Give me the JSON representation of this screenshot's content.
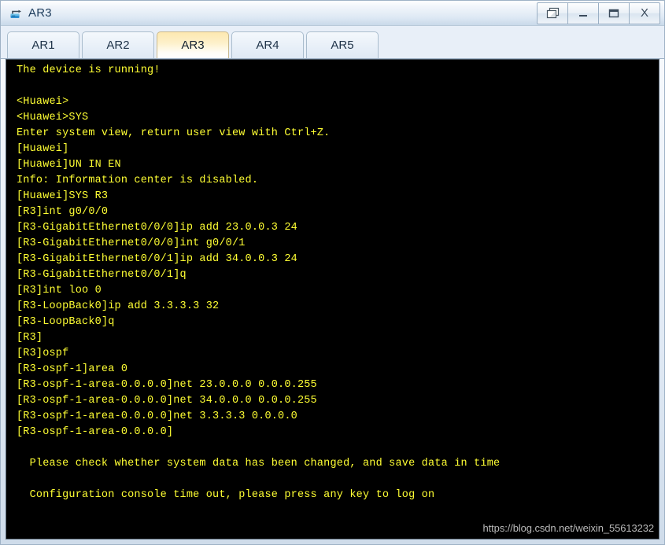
{
  "window": {
    "title": "AR3",
    "icon": "router-device-icon",
    "controls": [
      {
        "name": "restore-cascade-button",
        "label": "",
        "icon": "cascade-windows-icon"
      },
      {
        "name": "minimize-button",
        "label": "",
        "icon": "minimize-icon"
      },
      {
        "name": "maximize-button",
        "label": "",
        "icon": "maximize-icon"
      },
      {
        "name": "close-button",
        "label": "X",
        "icon": "close-icon"
      }
    ]
  },
  "tabs": {
    "active_index": 2,
    "items": [
      {
        "label": "AR1"
      },
      {
        "label": "AR2"
      },
      {
        "label": "AR3"
      },
      {
        "label": "AR4"
      },
      {
        "label": "AR5"
      }
    ]
  },
  "terminal": {
    "foreground_color": "#ffff33",
    "background_color": "#000000",
    "lines": [
      "The device is running!",
      "",
      "<Huawei>",
      "<Huawei>SYS",
      "Enter system view, return user view with Ctrl+Z.",
      "[Huawei]",
      "[Huawei]UN IN EN",
      "Info: Information center is disabled.",
      "[Huawei]SYS R3",
      "[R3]int g0/0/0",
      "[R3-GigabitEthernet0/0/0]ip add 23.0.0.3 24",
      "[R3-GigabitEthernet0/0/0]int g0/0/1",
      "[R3-GigabitEthernet0/0/1]ip add 34.0.0.3 24",
      "[R3-GigabitEthernet0/0/1]q",
      "[R3]int loo 0",
      "[R3-LoopBack0]ip add 3.3.3.3 32",
      "[R3-LoopBack0]q",
      "[R3]",
      "[R3]ospf",
      "[R3-ospf-1]area 0",
      "[R3-ospf-1-area-0.0.0.0]net 23.0.0.0 0.0.0.255",
      "[R3-ospf-1-area-0.0.0.0]net 34.0.0.0 0.0.0.255",
      "[R3-ospf-1-area-0.0.0.0]net 3.3.3.3 0.0.0.0",
      "[R3-ospf-1-area-0.0.0.0]",
      "",
      "  Please check whether system data has been changed, and save data in time",
      "",
      "  Configuration console time out, please press any key to log on"
    ],
    "watermark": "https://blog.csdn.net/weixin_55613232"
  }
}
